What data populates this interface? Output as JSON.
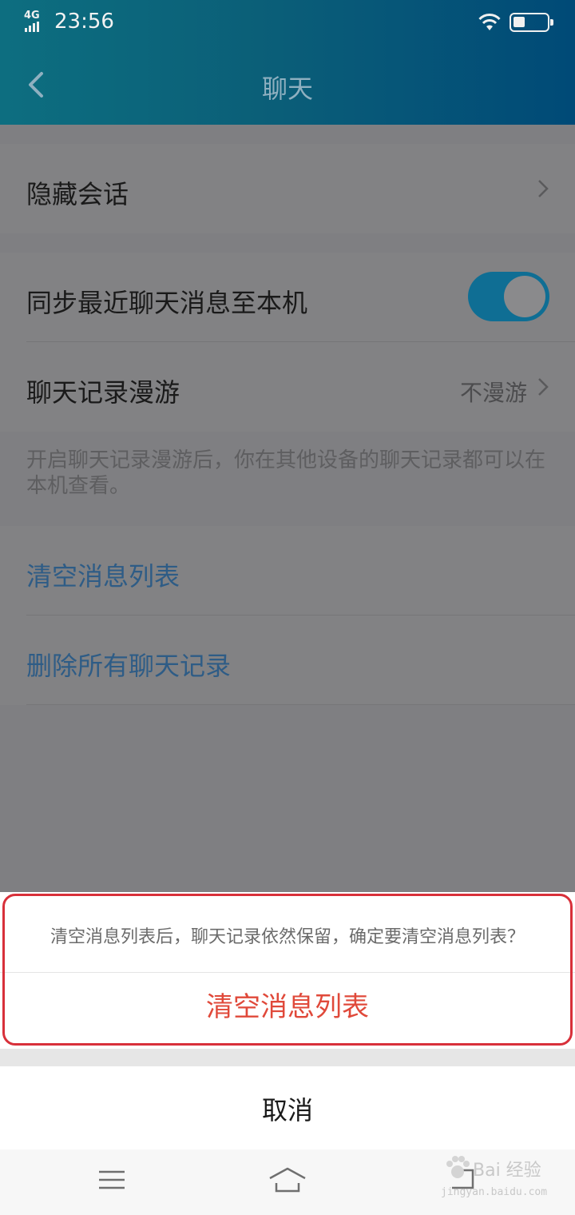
{
  "status_bar": {
    "network": "4G",
    "time": "23:56",
    "battery_level": 0.35
  },
  "nav": {
    "title": "聊天",
    "back_icon": "chevron-left-icon"
  },
  "settings": {
    "hidden_chats_label": "隐藏会话",
    "sync_label": "同步最近聊天消息至本机",
    "sync_enabled": true,
    "roaming_label": "聊天记录漫游",
    "roaming_value": "不漫游",
    "roaming_hint": "开启聊天记录漫游后，你在其他设备的聊天记录都可以在本机查看。",
    "clear_list_label": "清空消息列表",
    "delete_all_label": "删除所有聊天记录"
  },
  "action_sheet": {
    "message": "清空消息列表后，聊天记录依然保留，确定要清空消息列表？",
    "confirm_label": "清空消息列表",
    "cancel_label": "取消"
  },
  "navbar_icons": [
    "menu-icon",
    "home-icon",
    "back-icon"
  ],
  "watermark": {
    "text": "Bai 经验",
    "url": "jingyan.baidu.com"
  },
  "colors": {
    "header_start": "#0d6e80",
    "header_end": "#004a77",
    "toggle_on": "#0f6e94",
    "destructive": "#e0493a",
    "highlight": "#d8303a"
  }
}
